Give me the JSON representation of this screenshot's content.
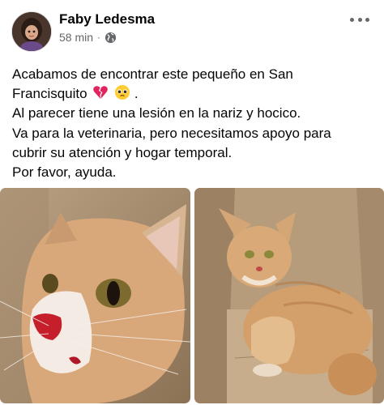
{
  "post": {
    "author": "Faby Ledesma",
    "time": "58 min",
    "separator": "·",
    "privacy_icon": "globe-icon",
    "more_icon": "more-dots-icon",
    "text_lines": [
      "Acabamos de encontrar este pequeño en San",
      "Francisquito",
      "Al parecer tiene una lesión en la nariz y hocico.",
      "Va para la veterinaria, pero necesitamos apoyo para",
      "cubrir su atención y hogar temporal.",
      "Por favor, ayuda."
    ],
    "emojis": [
      "broken-heart-emoji",
      "pleading-face-emoji"
    ],
    "trailing_period": "."
  },
  "photos": [
    {
      "name": "photo-cat-closeup",
      "icon": "cat-injured-nose-photo"
    },
    {
      "name": "photo-cat-in-box",
      "icon": "cat-in-box-photo"
    }
  ],
  "colors": {
    "text": "#050505",
    "meta": "#65676b",
    "background": "#ffffff"
  }
}
